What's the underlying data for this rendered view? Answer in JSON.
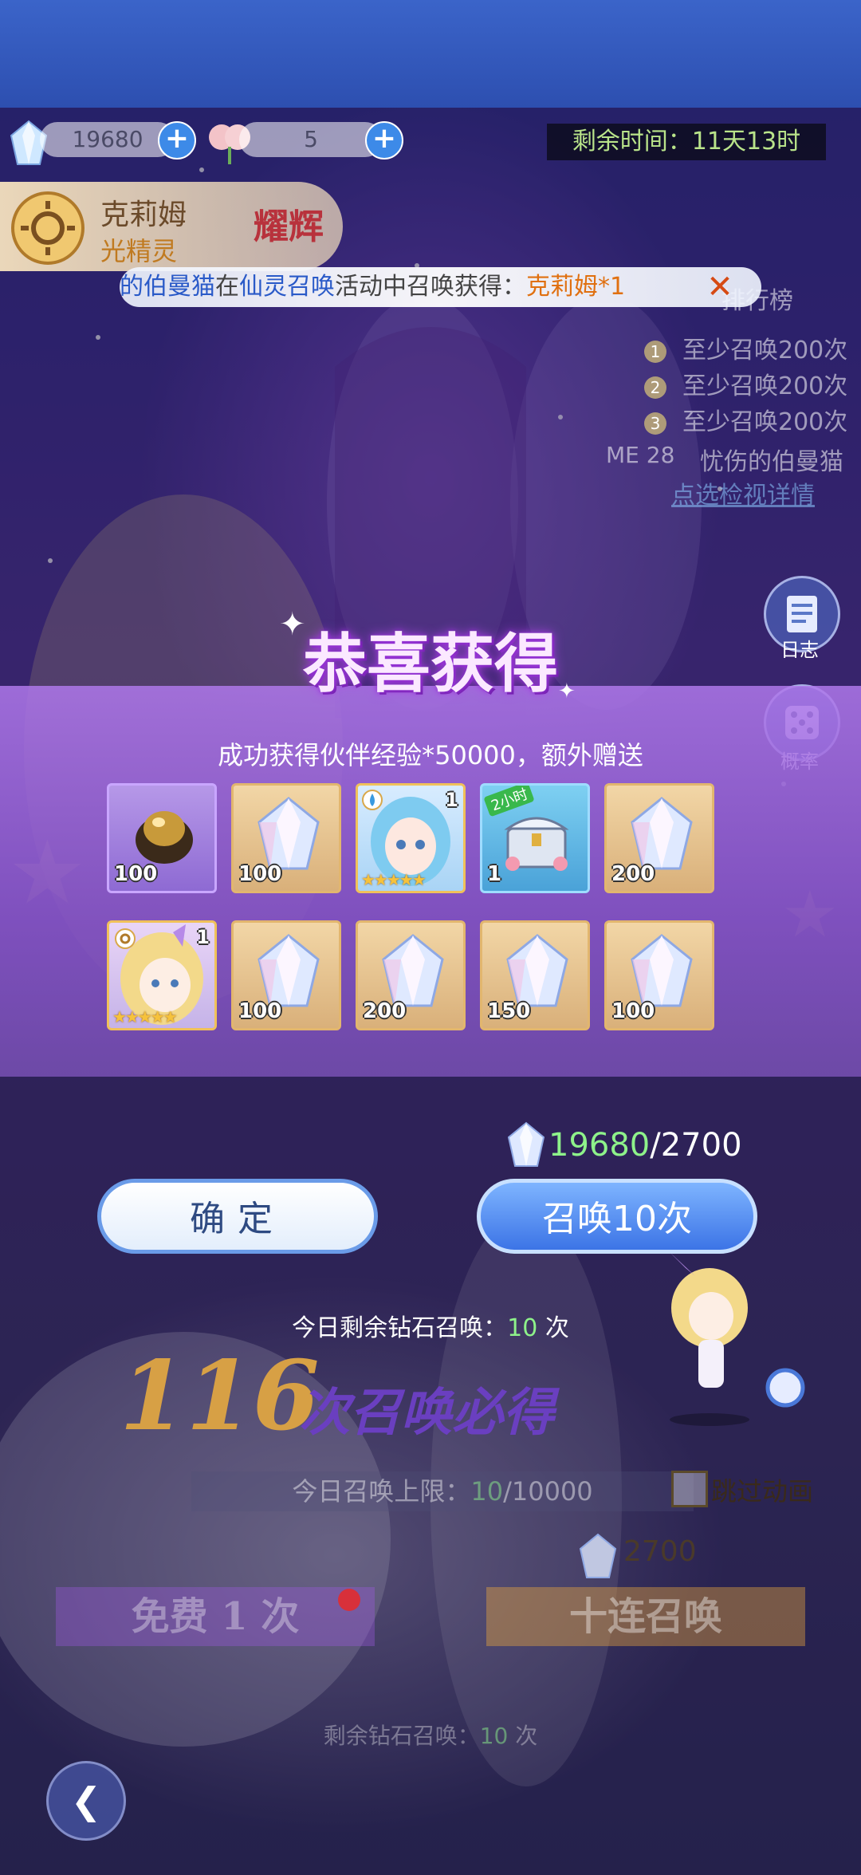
{
  "resources": {
    "diamond_amount": "19680",
    "ticket_amount": "5",
    "plus_label": "+"
  },
  "timer": {
    "text": "剩余时间：11天13时"
  },
  "character": {
    "name": "克莉姆",
    "class": "光精灵",
    "badge": "耀辉"
  },
  "notice": {
    "prefix": "的伯曼猫",
    "mid1": "在",
    "event": "仙灵召唤",
    "mid2": "活动中召唤获得：",
    "item": "克莉姆*1",
    "close": "✕"
  },
  "ranking": {
    "title": "排行榜",
    "entries": [
      {
        "rank": "1",
        "text": "至少召唤200次"
      },
      {
        "rank": "2",
        "text": "至少召唤200次"
      },
      {
        "rank": "3",
        "text": "至少召唤200次"
      }
    ],
    "me_rank": "ME 28",
    "me_name": "忧伤的伯曼猫",
    "detail_link": "点选检视详情"
  },
  "side_buttons": {
    "log_label": "日志",
    "rate_label": "概率"
  },
  "reward_popup": {
    "title": "恭喜获得",
    "subtitle": "成功获得伙伴经验*50000，额外赠送",
    "items": [
      {
        "type": "egg",
        "qty": "100",
        "frame": "purple"
      },
      {
        "type": "crystal",
        "qty": "100",
        "frame": "gold"
      },
      {
        "type": "character-water",
        "qty": "",
        "count": "1",
        "frame": "gold",
        "stars": "★★★★★"
      },
      {
        "type": "chest",
        "qty": "1",
        "frame": "blue",
        "tag": "2小时"
      },
      {
        "type": "crystal",
        "qty": "200",
        "frame": "gold"
      },
      {
        "type": "character-light",
        "qty": "",
        "count": "1",
        "frame": "char",
        "stars": "★★★★★"
      },
      {
        "type": "crystal",
        "qty": "100",
        "frame": "gold"
      },
      {
        "type": "crystal",
        "qty": "200",
        "frame": "gold"
      },
      {
        "type": "crystal",
        "qty": "150",
        "frame": "gold"
      },
      {
        "type": "crystal",
        "qty": "100",
        "frame": "gold"
      }
    ]
  },
  "cost": {
    "have": "19680",
    "sep": "/",
    "need": "2700"
  },
  "buttons": {
    "confirm": "确定",
    "summon10": "召唤10次"
  },
  "today_remain": {
    "label": "今日剩余钻石召唤：",
    "count": "10",
    "unit": " 次"
  },
  "guarantee": {
    "number": "116",
    "text": "次召唤必得"
  },
  "limit": {
    "label": "今日召唤上限：",
    "used": "10",
    "max": "/10000"
  },
  "skip_label": "跳过动画",
  "bottom": {
    "cost": "2700",
    "free_button": "免费 1 次",
    "ten_button": "十连召唤",
    "remain_label": "剩余钻石召唤：",
    "remain_count": "10",
    "remain_unit": " 次"
  },
  "colors": {
    "accent_green": "#8ef28a",
    "primary_blue": "#3c74e6",
    "title_purple": "#b44ae8"
  }
}
